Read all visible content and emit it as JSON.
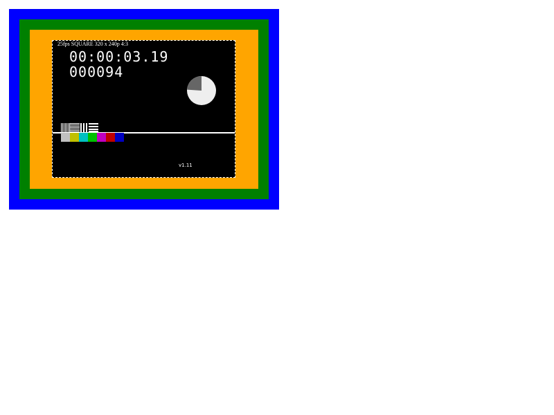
{
  "colors": {
    "outer_border": "#0000ff",
    "middle_border": "#008000",
    "inner_border": "#ffa500",
    "video_background": "#000000",
    "text": "#ffffff",
    "pie_fill": "#eeeeee",
    "pie_slice": "#666666"
  },
  "overlay": {
    "header": "25fps SQUARE 320 x 240p 4:3",
    "timecode": "00:00:03.19",
    "frame_counter": "000094",
    "version": "v1.11"
  },
  "pie_progress": 0.76,
  "color_bars": [
    "#c0c0c0",
    "#c0c000",
    "#00c0c0",
    "#00c000",
    "#c000c0",
    "#c00000",
    "#0000c0"
  ],
  "patterns": [
    "vertical-lines",
    "horizontal-lines",
    "vertical-lines",
    "horizontal-lines"
  ]
}
